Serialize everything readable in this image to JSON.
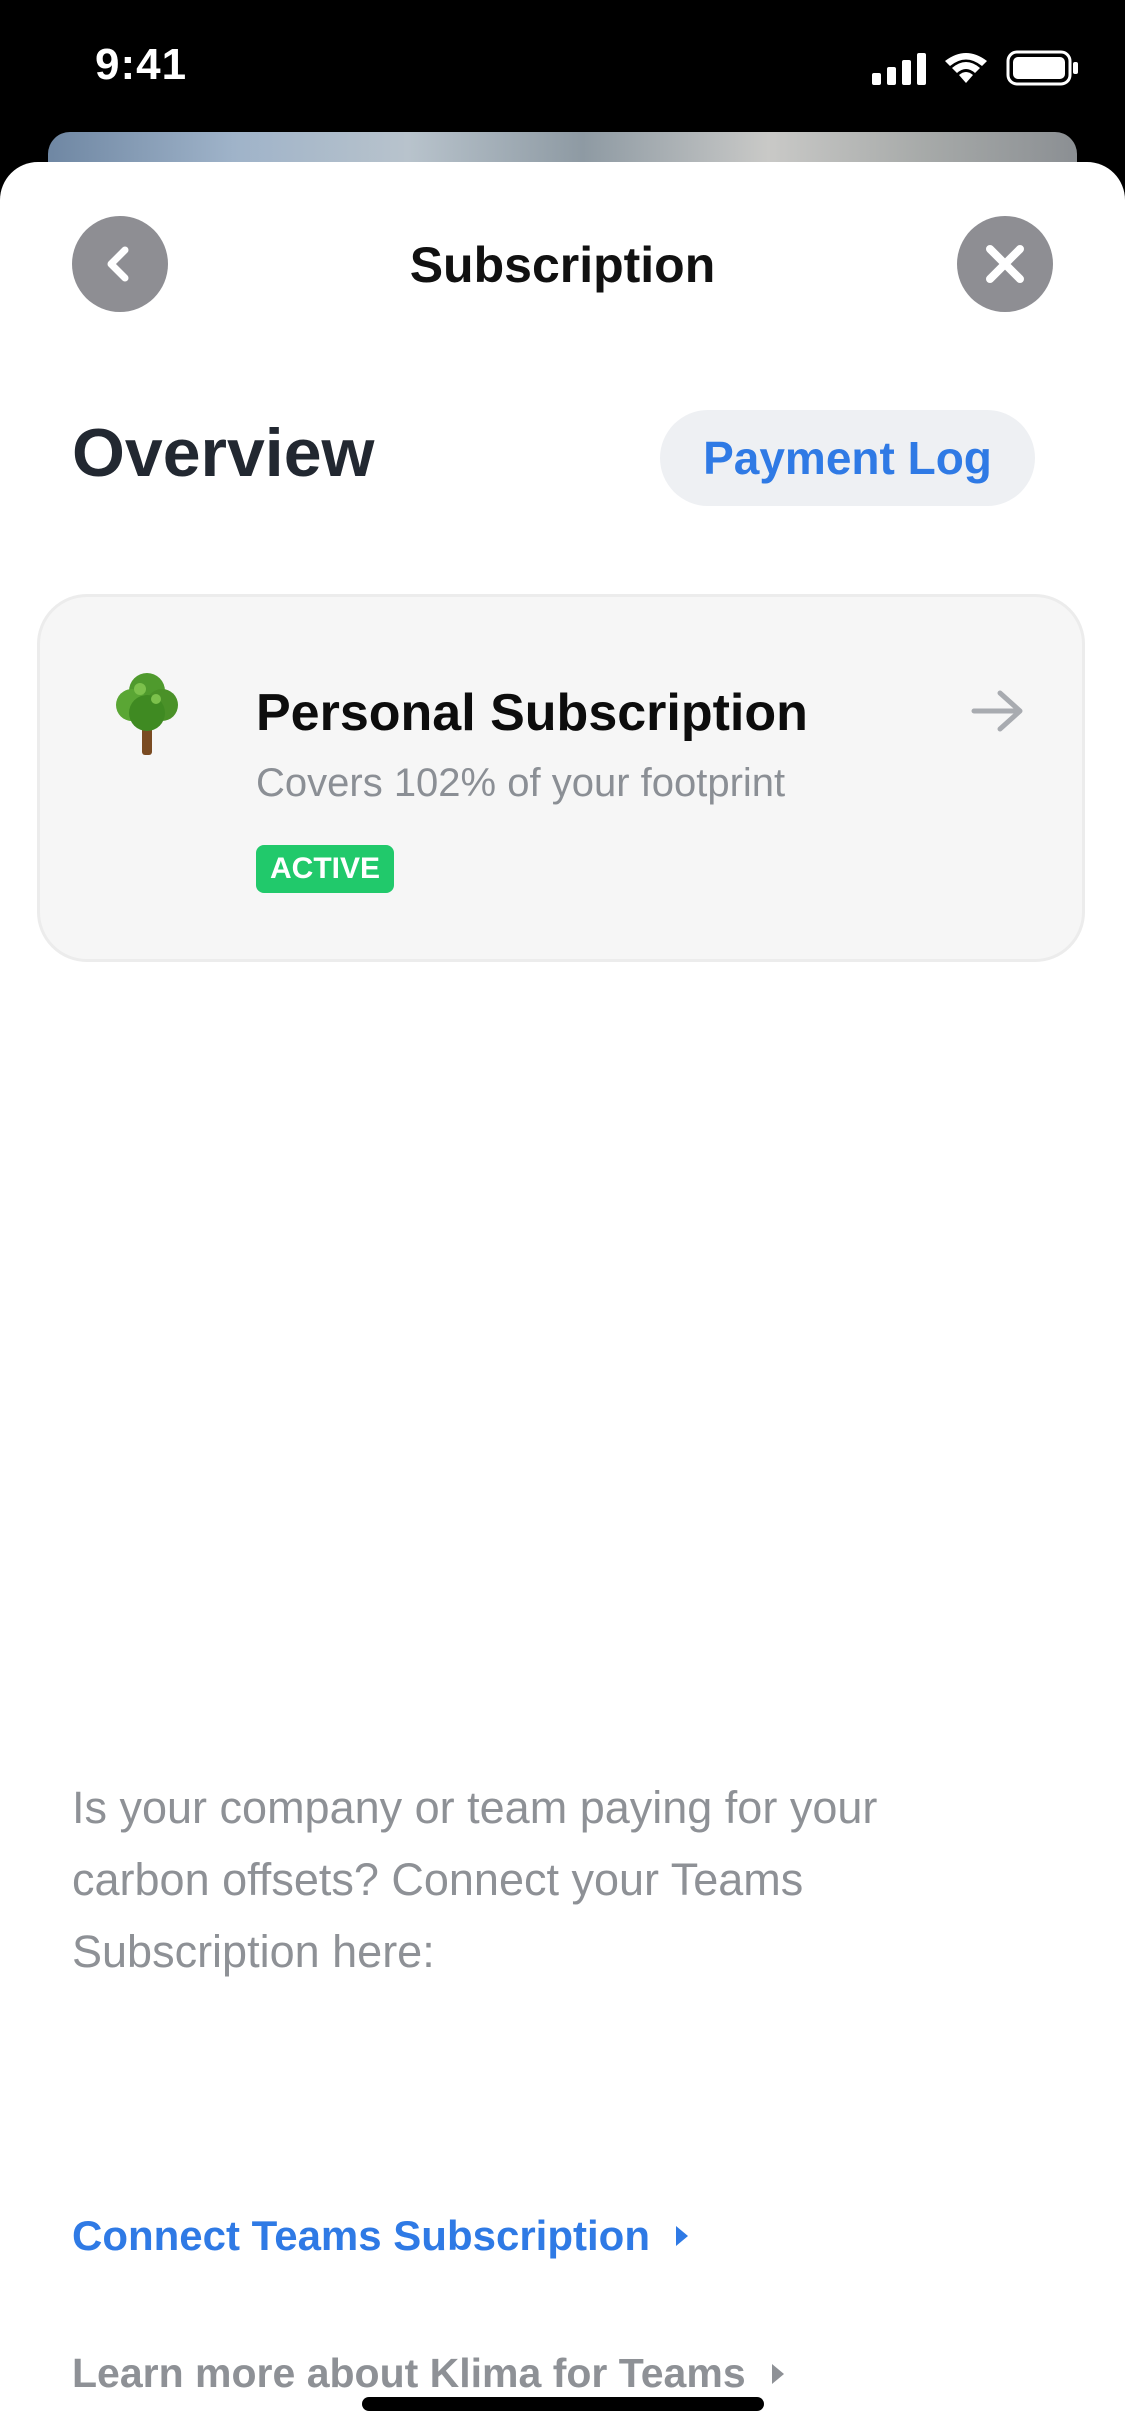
{
  "status_bar": {
    "time": "9:41"
  },
  "header": {
    "title": "Subscription"
  },
  "overview": {
    "heading": "Overview",
    "payment_log_label": "Payment Log"
  },
  "subscription_card": {
    "title": "Personal Subscription",
    "subtitle": "Covers 102% of your footprint",
    "badge": "ACTIVE",
    "icon": "tree-icon"
  },
  "teams": {
    "description": "Is your company or team paying for your carbon offsets? Connect your Teams Subscription here:",
    "connect_label": "Connect Teams Subscription",
    "learn_more_label": "Learn more about Klima for Teams"
  },
  "colors": {
    "accent": "#2f7ae5",
    "active_badge": "#21c96b",
    "muted_text": "#8e9196",
    "circle_button": "#8e8e93"
  }
}
